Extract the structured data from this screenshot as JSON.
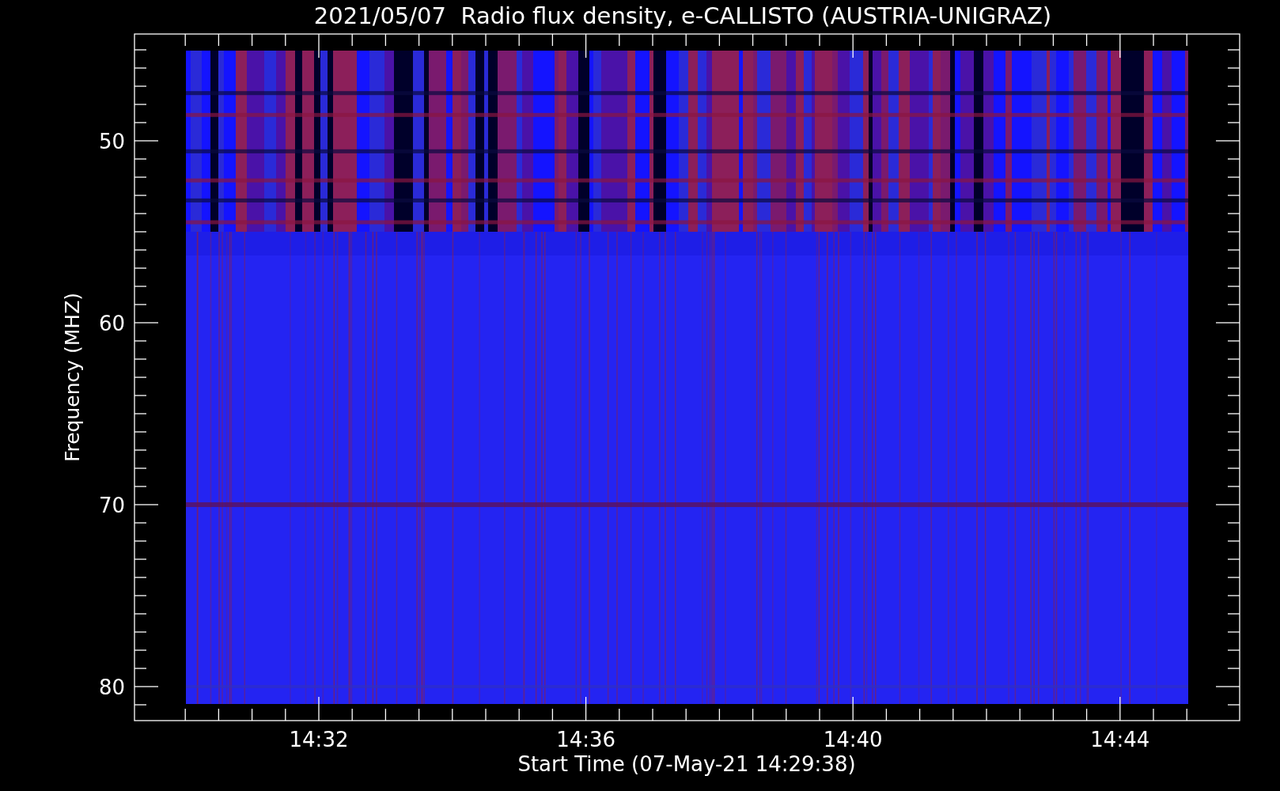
{
  "title": "2021/05/07  Radio flux density, e-CALLISTO (AUSTRIA-UNIGRAZ)",
  "y_axis": {
    "label": "Frequency (MHZ)",
    "ticks": [
      "50",
      "60",
      "70",
      "80"
    ]
  },
  "x_axis": {
    "label": "Start Time (07-May-21 14:29:38)",
    "ticks": [
      "14:32",
      "14:36",
      "14:40",
      "14:44"
    ]
  }
}
